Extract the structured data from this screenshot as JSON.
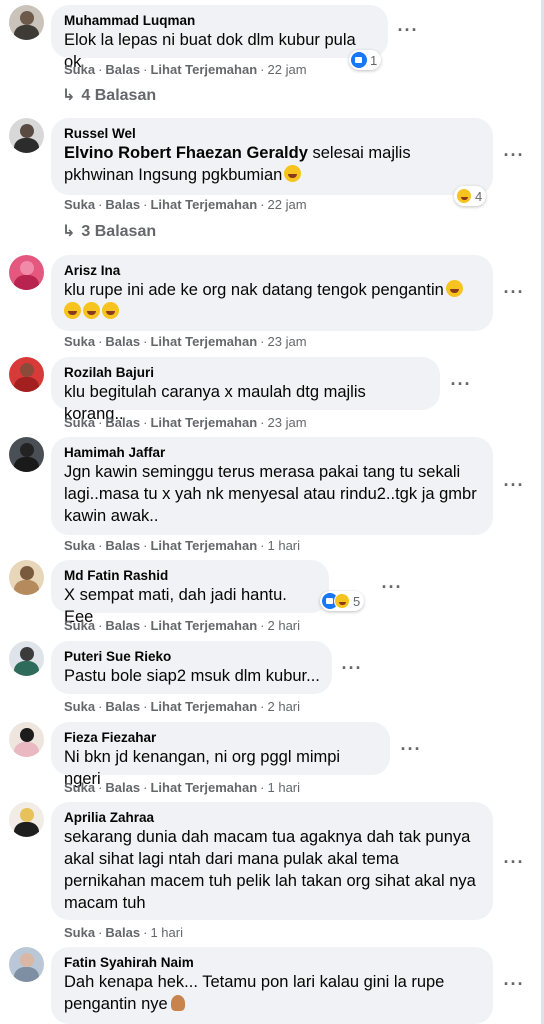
{
  "actions": {
    "like": "Suka",
    "reply": "Balas",
    "translate": "Lihat Terjemahan"
  },
  "comments": [
    {
      "author": "Muhammad Luqman",
      "text": "Elok la lepas ni buat dok dlm kubur pula ok",
      "time": "22 jam",
      "reaction_count": "1",
      "replies": "4 Balasan"
    },
    {
      "author": "Russel Wel",
      "mention": "Elvino Robert Fhaezan Geraldy",
      "text": " selesai majlis pkhwinan Ingsung pgkbumian",
      "time": "22 jam",
      "reaction_count": "4",
      "replies": "3 Balasan"
    },
    {
      "author": "Arisz Ina",
      "text": "klu rupe ini ade ke org nak datang tengok pengantin",
      "time": "23 jam"
    },
    {
      "author": "Rozilah Bajuri",
      "text": "klu begitulah caranya x maulah dtg majlis korang..",
      "time": "23 jam"
    },
    {
      "author": "Hamimah Jaffar",
      "text": "Jgn kawin seminggu terus merasa pakai tang tu sekali lagi..masa tu x yah nk menyesal atau rindu2..tgk ja gmbr kawin awak..",
      "time": "1 hari"
    },
    {
      "author": "Md Fatin Rashid",
      "text": "X sempat mati, dah jadi hantu. Eee",
      "time": "2 hari",
      "reaction_count": "5"
    },
    {
      "author": "Puteri Sue Rieko",
      "text": "Pastu bole siap2 msuk dlm kubur...",
      "time": "2 hari"
    },
    {
      "author": "Fieza Fiezahar",
      "text": "Ni bkn jd kenangan, ni org pggl mimpi ngeri",
      "time": "1 hari"
    },
    {
      "author": "Aprilia Zahraa",
      "text": "sekarang dunia dah macam tua agaknya dah tak punya akal sihat lagi ntah dari mana pulak akal tema pernikahan macem tuh pelik lah takan org sihat akal nya macam tuh",
      "time": "1 hari"
    },
    {
      "author": "Fatin Syahirah Naim",
      "text": "Dah kenapa hek... Tetamu pon lari kalau gini la rupe pengantin nye"
    }
  ]
}
